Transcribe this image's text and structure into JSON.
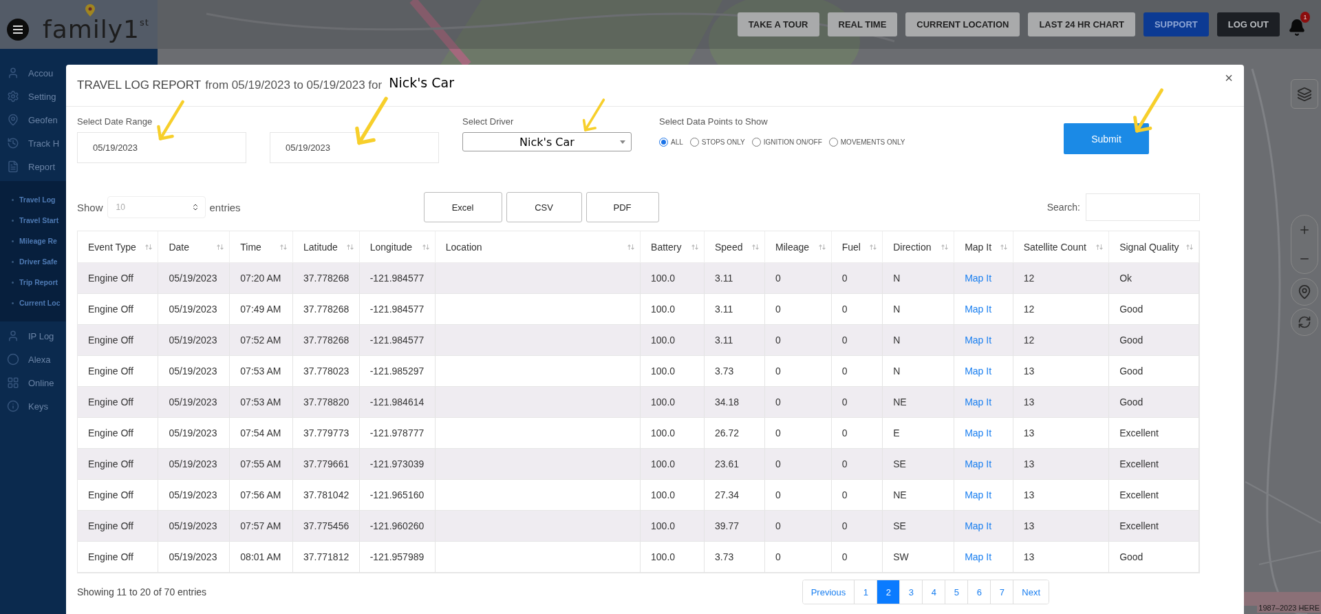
{
  "brand": {
    "logo": "family1$^{st}$"
  },
  "top_buttons": [
    {
      "label": "TAKE A TOUR",
      "kind": "plain"
    },
    {
      "label": "REAL TIME",
      "kind": "plain"
    },
    {
      "label": "CURRENT LOCATION",
      "kind": "plain"
    },
    {
      "label": "LAST 24 HR CHART",
      "kind": "plain"
    },
    {
      "label": "SUPPORT",
      "kind": "primary"
    },
    {
      "label": "LOG OUT",
      "kind": "dark"
    }
  ],
  "notifications": {
    "count": "1"
  },
  "sidebar": {
    "items": [
      {
        "label": "Accou"
      },
      {
        "label": "Setting"
      },
      {
        "label": "Geofen"
      },
      {
        "label": "Track H"
      },
      {
        "label": "Report",
        "children": [
          {
            "label": "Travel Log"
          },
          {
            "label": "Travel Start"
          },
          {
            "label": "Mileage Re"
          },
          {
            "label": "Driver Safe"
          },
          {
            "label": "Trip Report"
          },
          {
            "label": "Current Loc"
          }
        ]
      },
      {
        "label": "IP Log"
      },
      {
        "label": "Alexa"
      },
      {
        "label": "Online"
      },
      {
        "label": "Keys"
      }
    ]
  },
  "map": {
    "attribution": "1987–2023 HERE"
  },
  "modal": {
    "title": {
      "report": "TRAVEL LOG REPORT",
      "range": "from 05/19/2023 to 05/19/2023 for",
      "vehicle": "Nick's Car"
    },
    "close": "×",
    "date_range": {
      "label": "Select Date Range",
      "from": "05/19/2023",
      "to": "05/19/2023"
    },
    "driver": {
      "label": "Select Driver",
      "value": "Nick's Car"
    },
    "data_points": {
      "label": "Select Data Points to Show",
      "options": [
        {
          "label": "ALL",
          "selected": true
        },
        {
          "label": "STOPS ONLY",
          "selected": false
        },
        {
          "label": "IGNITION ON/OFF",
          "selected": false
        },
        {
          "label": "MOVEMENTS ONLY",
          "selected": false
        }
      ]
    },
    "submit": "Submit",
    "show": {
      "before": "Show",
      "value": "10",
      "after": "entries"
    },
    "exports": [
      "Excel",
      "CSV",
      "PDF"
    ],
    "search": {
      "label": "Search:"
    },
    "table": {
      "columns": [
        "Event Type",
        "Date",
        "Time",
        "Latitude",
        "Longitude",
        "Location",
        "Battery",
        "Speed",
        "Mileage",
        "Fuel",
        "Direction",
        "Map It",
        "Satellite Count",
        "Signal Quality"
      ],
      "rows": [
        {
          "event_type": "Engine Off",
          "date": "05/19/2023",
          "time": "07:20 AM",
          "latitude": "37.778268",
          "longitude": "-121.984577",
          "battery": "100.0",
          "speed": "3.11",
          "mileage": "0",
          "fuel": "0",
          "direction": "N",
          "map_it": "Map It",
          "satellite_count": "12",
          "signal_quality": "Ok"
        },
        {
          "event_type": "Engine Off",
          "date": "05/19/2023",
          "time": "07:49 AM",
          "latitude": "37.778268",
          "longitude": "-121.984577",
          "battery": "100.0",
          "speed": "3.11",
          "mileage": "0",
          "fuel": "0",
          "direction": "N",
          "map_it": "Map It",
          "satellite_count": "12",
          "signal_quality": "Good"
        },
        {
          "event_type": "Engine Off",
          "date": "05/19/2023",
          "time": "07:52 AM",
          "latitude": "37.778268",
          "longitude": "-121.984577",
          "battery": "100.0",
          "speed": "3.11",
          "mileage": "0",
          "fuel": "0",
          "direction": "N",
          "map_it": "Map It",
          "satellite_count": "12",
          "signal_quality": "Good"
        },
        {
          "event_type": "Engine Off",
          "date": "05/19/2023",
          "time": "07:53 AM",
          "latitude": "37.778023",
          "longitude": "-121.985297",
          "battery": "100.0",
          "speed": "3.73",
          "mileage": "0",
          "fuel": "0",
          "direction": "N",
          "map_it": "Map It",
          "satellite_count": "13",
          "signal_quality": "Good"
        },
        {
          "event_type": "Engine Off",
          "date": "05/19/2023",
          "time": "07:53 AM",
          "latitude": "37.778820",
          "longitude": "-121.984614",
          "battery": "100.0",
          "speed": "34.18",
          "mileage": "0",
          "fuel": "0",
          "direction": "NE",
          "map_it": "Map It",
          "satellite_count": "13",
          "signal_quality": "Good"
        },
        {
          "event_type": "Engine Off",
          "date": "05/19/2023",
          "time": "07:54 AM",
          "latitude": "37.779773",
          "longitude": "-121.978777",
          "battery": "100.0",
          "speed": "26.72",
          "mileage": "0",
          "fuel": "0",
          "direction": "E",
          "map_it": "Map It",
          "satellite_count": "13",
          "signal_quality": "Excellent"
        },
        {
          "event_type": "Engine Off",
          "date": "05/19/2023",
          "time": "07:55 AM",
          "latitude": "37.779661",
          "longitude": "-121.973039",
          "battery": "100.0",
          "speed": "23.61",
          "mileage": "0",
          "fuel": "0",
          "direction": "SE",
          "map_it": "Map It",
          "satellite_count": "13",
          "signal_quality": "Excellent"
        },
        {
          "event_type": "Engine Off",
          "date": "05/19/2023",
          "time": "07:56 AM",
          "latitude": "37.781042",
          "longitude": "-121.965160",
          "battery": "100.0",
          "speed": "27.34",
          "mileage": "0",
          "fuel": "0",
          "direction": "NE",
          "map_it": "Map It",
          "satellite_count": "13",
          "signal_quality": "Excellent"
        },
        {
          "event_type": "Engine Off",
          "date": "05/19/2023",
          "time": "07:57 AM",
          "latitude": "37.775456",
          "longitude": "-121.960260",
          "battery": "100.0",
          "speed": "39.77",
          "mileage": "0",
          "fuel": "0",
          "direction": "SE",
          "map_it": "Map It",
          "satellite_count": "13",
          "signal_quality": "Excellent"
        },
        {
          "event_type": "Engine Off",
          "date": "05/19/2023",
          "time": "08:01 AM",
          "latitude": "37.771812",
          "longitude": "-121.957989",
          "battery": "100.0",
          "speed": "3.73",
          "mileage": "0",
          "fuel": "0",
          "direction": "SW",
          "map_it": "Map It",
          "satellite_count": "13",
          "signal_quality": "Good"
        }
      ]
    },
    "summary": "Showing 11 to 20 of 70 entries",
    "pagination": {
      "previous": "Previous",
      "next": "Next",
      "pages": [
        {
          "label": "1",
          "selected": false
        },
        {
          "label": "2",
          "selected": true
        },
        {
          "label": "3",
          "selected": false
        },
        {
          "label": "4",
          "selected": false
        },
        {
          "label": "5",
          "selected": false
        },
        {
          "label": "6",
          "selected": false
        },
        {
          "label": "7",
          "selected": false
        }
      ]
    }
  }
}
